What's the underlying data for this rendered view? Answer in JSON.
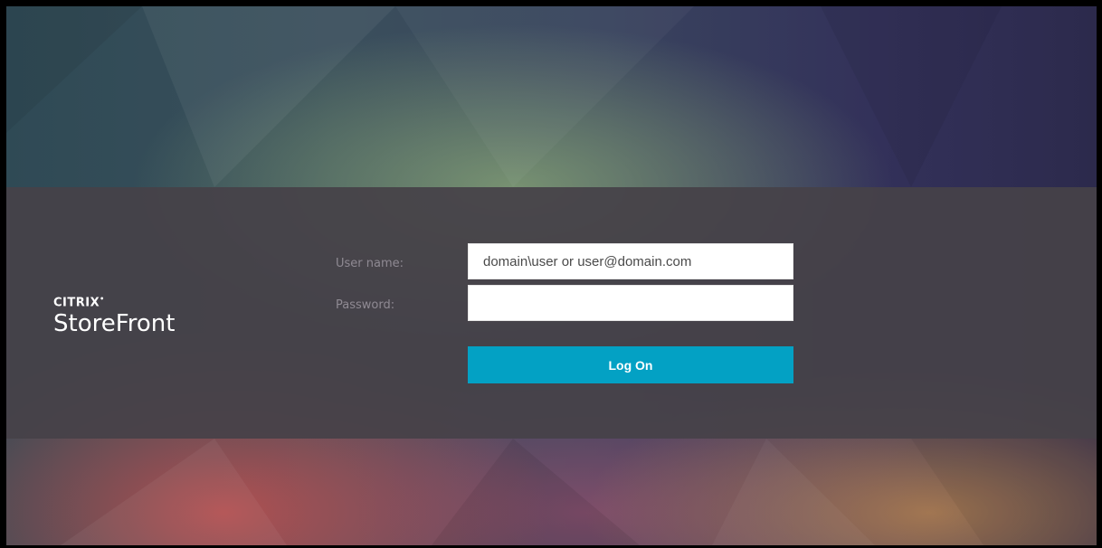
{
  "brand": {
    "company": "CITRIX",
    "product": "StoreFront"
  },
  "login": {
    "username_label": "User name:",
    "username_placeholder": "domain\\user or user@domain.com",
    "username_value": "",
    "password_label": "Password:",
    "password_value": "",
    "logon_label": "Log On"
  },
  "colors": {
    "accent": "#03a1c4",
    "band": "#464248",
    "label_text": "#8f8a93"
  }
}
